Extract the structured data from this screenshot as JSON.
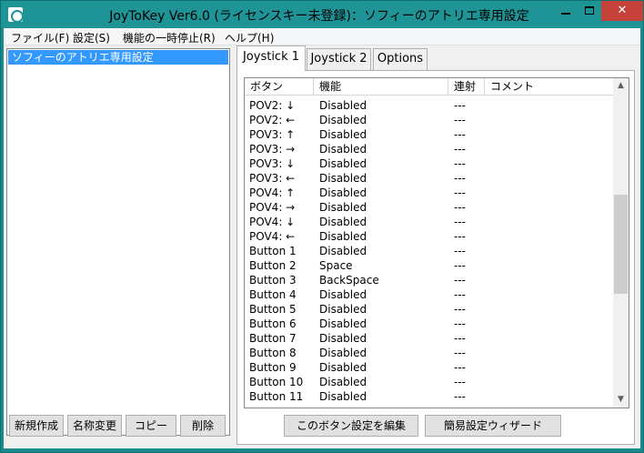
{
  "window": {
    "title": "JoyToKey Ver6.0 (ライセンスキー未登録)：ソフィーのアトリエ専用設定",
    "controls": {
      "minimize": "",
      "maximize": "",
      "close": "✕"
    }
  },
  "menu": [
    "ファイル(F)",
    "設定(S)",
    "機能の一時停止(R)",
    "ヘルプ(H)"
  ],
  "profiles": {
    "items": [
      "ソフィーのアトリエ専用設定"
    ],
    "selected": 0
  },
  "profile_buttons": [
    "新規作成",
    "名称変更",
    "コピー",
    "削除"
  ],
  "tabs": [
    "Joystick 1",
    "Joystick 2",
    "Options"
  ],
  "active_tab": 0,
  "list": {
    "columns": [
      "ボタン",
      "機能",
      "連射",
      "コメント"
    ],
    "rows": [
      {
        "button": "POV2: ↓",
        "function": "Disabled",
        "rapid": "---",
        "comment": ""
      },
      {
        "button": "POV2: ←",
        "function": "Disabled",
        "rapid": "---",
        "comment": ""
      },
      {
        "button": "POV3: ↑",
        "function": "Disabled",
        "rapid": "---",
        "comment": ""
      },
      {
        "button": "POV3: →",
        "function": "Disabled",
        "rapid": "---",
        "comment": ""
      },
      {
        "button": "POV3: ↓",
        "function": "Disabled",
        "rapid": "---",
        "comment": ""
      },
      {
        "button": "POV3: ←",
        "function": "Disabled",
        "rapid": "---",
        "comment": ""
      },
      {
        "button": "POV4: ↑",
        "function": "Disabled",
        "rapid": "---",
        "comment": ""
      },
      {
        "button": "POV4: →",
        "function": "Disabled",
        "rapid": "---",
        "comment": ""
      },
      {
        "button": "POV4: ↓",
        "function": "Disabled",
        "rapid": "---",
        "comment": ""
      },
      {
        "button": "POV4: ←",
        "function": "Disabled",
        "rapid": "---",
        "comment": ""
      },
      {
        "button": "Button 1",
        "function": "Disabled",
        "rapid": "---",
        "comment": ""
      },
      {
        "button": "Button 2",
        "function": "Space",
        "rapid": "---",
        "comment": ""
      },
      {
        "button": "Button 3",
        "function": "BackSpace",
        "rapid": "---",
        "comment": ""
      },
      {
        "button": "Button 4",
        "function": "Disabled",
        "rapid": "---",
        "comment": ""
      },
      {
        "button": "Button 5",
        "function": "Disabled",
        "rapid": "---",
        "comment": ""
      },
      {
        "button": "Button 6",
        "function": "Disabled",
        "rapid": "---",
        "comment": ""
      },
      {
        "button": "Button 7",
        "function": "Disabled",
        "rapid": "---",
        "comment": ""
      },
      {
        "button": "Button 8",
        "function": "Disabled",
        "rapid": "---",
        "comment": ""
      },
      {
        "button": "Button 9",
        "function": "Disabled",
        "rapid": "---",
        "comment": ""
      },
      {
        "button": "Button 10",
        "function": "Disabled",
        "rapid": "---",
        "comment": ""
      },
      {
        "button": "Button 11",
        "function": "Disabled",
        "rapid": "---",
        "comment": ""
      }
    ],
    "scrollbar": {
      "up_arrow": "▲",
      "down_arrow": "▼"
    }
  },
  "panel_buttons": [
    "このボタン設定を編集",
    "簡易設定ウィザード"
  ],
  "colors": {
    "title_bar": "#1e9496",
    "selection": "#3399ff",
    "close_button": "#c7413b"
  }
}
